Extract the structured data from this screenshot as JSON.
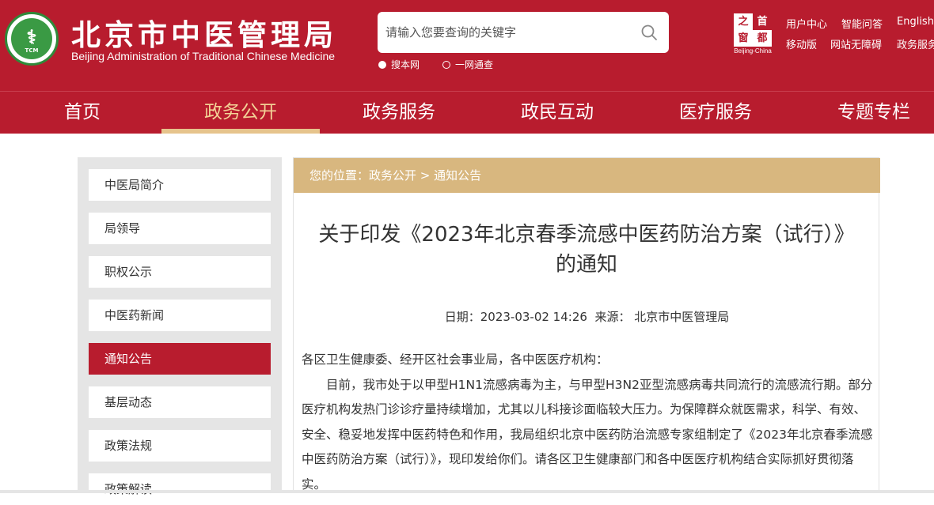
{
  "header": {
    "title": "北京市中医管理局",
    "subtitle": "Beijing Administration of Traditional Chinese Medicine",
    "emblem_text": "TCM",
    "search": {
      "placeholder": "请输入您要查询的关键字",
      "options": [
        "搜本网",
        "一网通查"
      ],
      "selected": "搜本网"
    },
    "capital_logo": {
      "chars": [
        "之",
        "首",
        "窗",
        "都"
      ],
      "label": "Beijing-China"
    },
    "links_row1": [
      "用户中心",
      "智能问答",
      "English"
    ],
    "links_row2": [
      "移动版",
      "网站无障碍",
      "政务服务"
    ]
  },
  "nav": {
    "items": [
      "首页",
      "政务公开",
      "政务服务",
      "政民互动",
      "医疗服务",
      "专题专栏"
    ],
    "active": "政务公开"
  },
  "sidebar": {
    "items": [
      "中医局简介",
      "局领导",
      "职权公示",
      "中医药新闻",
      "通知公告",
      "基层动态",
      "政策法规",
      "政策解读"
    ],
    "active": "通知公告"
  },
  "breadcrumb": {
    "prefix": "您的位置：",
    "items": [
      "政务公开",
      "通知公告"
    ],
    "separator": " > "
  },
  "article": {
    "title": "关于印发《2023年北京春季流感中医药防治方案（试行）》的通知",
    "date_label": "日期：",
    "date": "2023-03-02 14:26",
    "source_label": "来源：",
    "source": "北京市中医管理局",
    "paragraphs": [
      "各区卫生健康委、经开区社会事业局，各中医医疗机构：",
      "目前，我市处于以甲型H1N1流感病毒为主，与甲型H3N2亚型流感病毒共同流行的流感流行期。部分医疗机构发热门诊诊疗量持续增加，尤其以儿科接诊面临较大压力。为保障群众就医需求，科学、有效、安全、稳妥地发挥中医药特色和作用，我局组织北京中医药防治流感专家组制定了《2023年北京春季流感中医药防治方案（试行）》，现印发给你们。请各区卫生健康部门和各中医医疗机构结合实际抓好贯彻落实。"
    ]
  },
  "colors": {
    "brand_red": "#b81c2e",
    "breadcrumb_gold": "#d8b77f",
    "nav_active": "#f3d397"
  }
}
